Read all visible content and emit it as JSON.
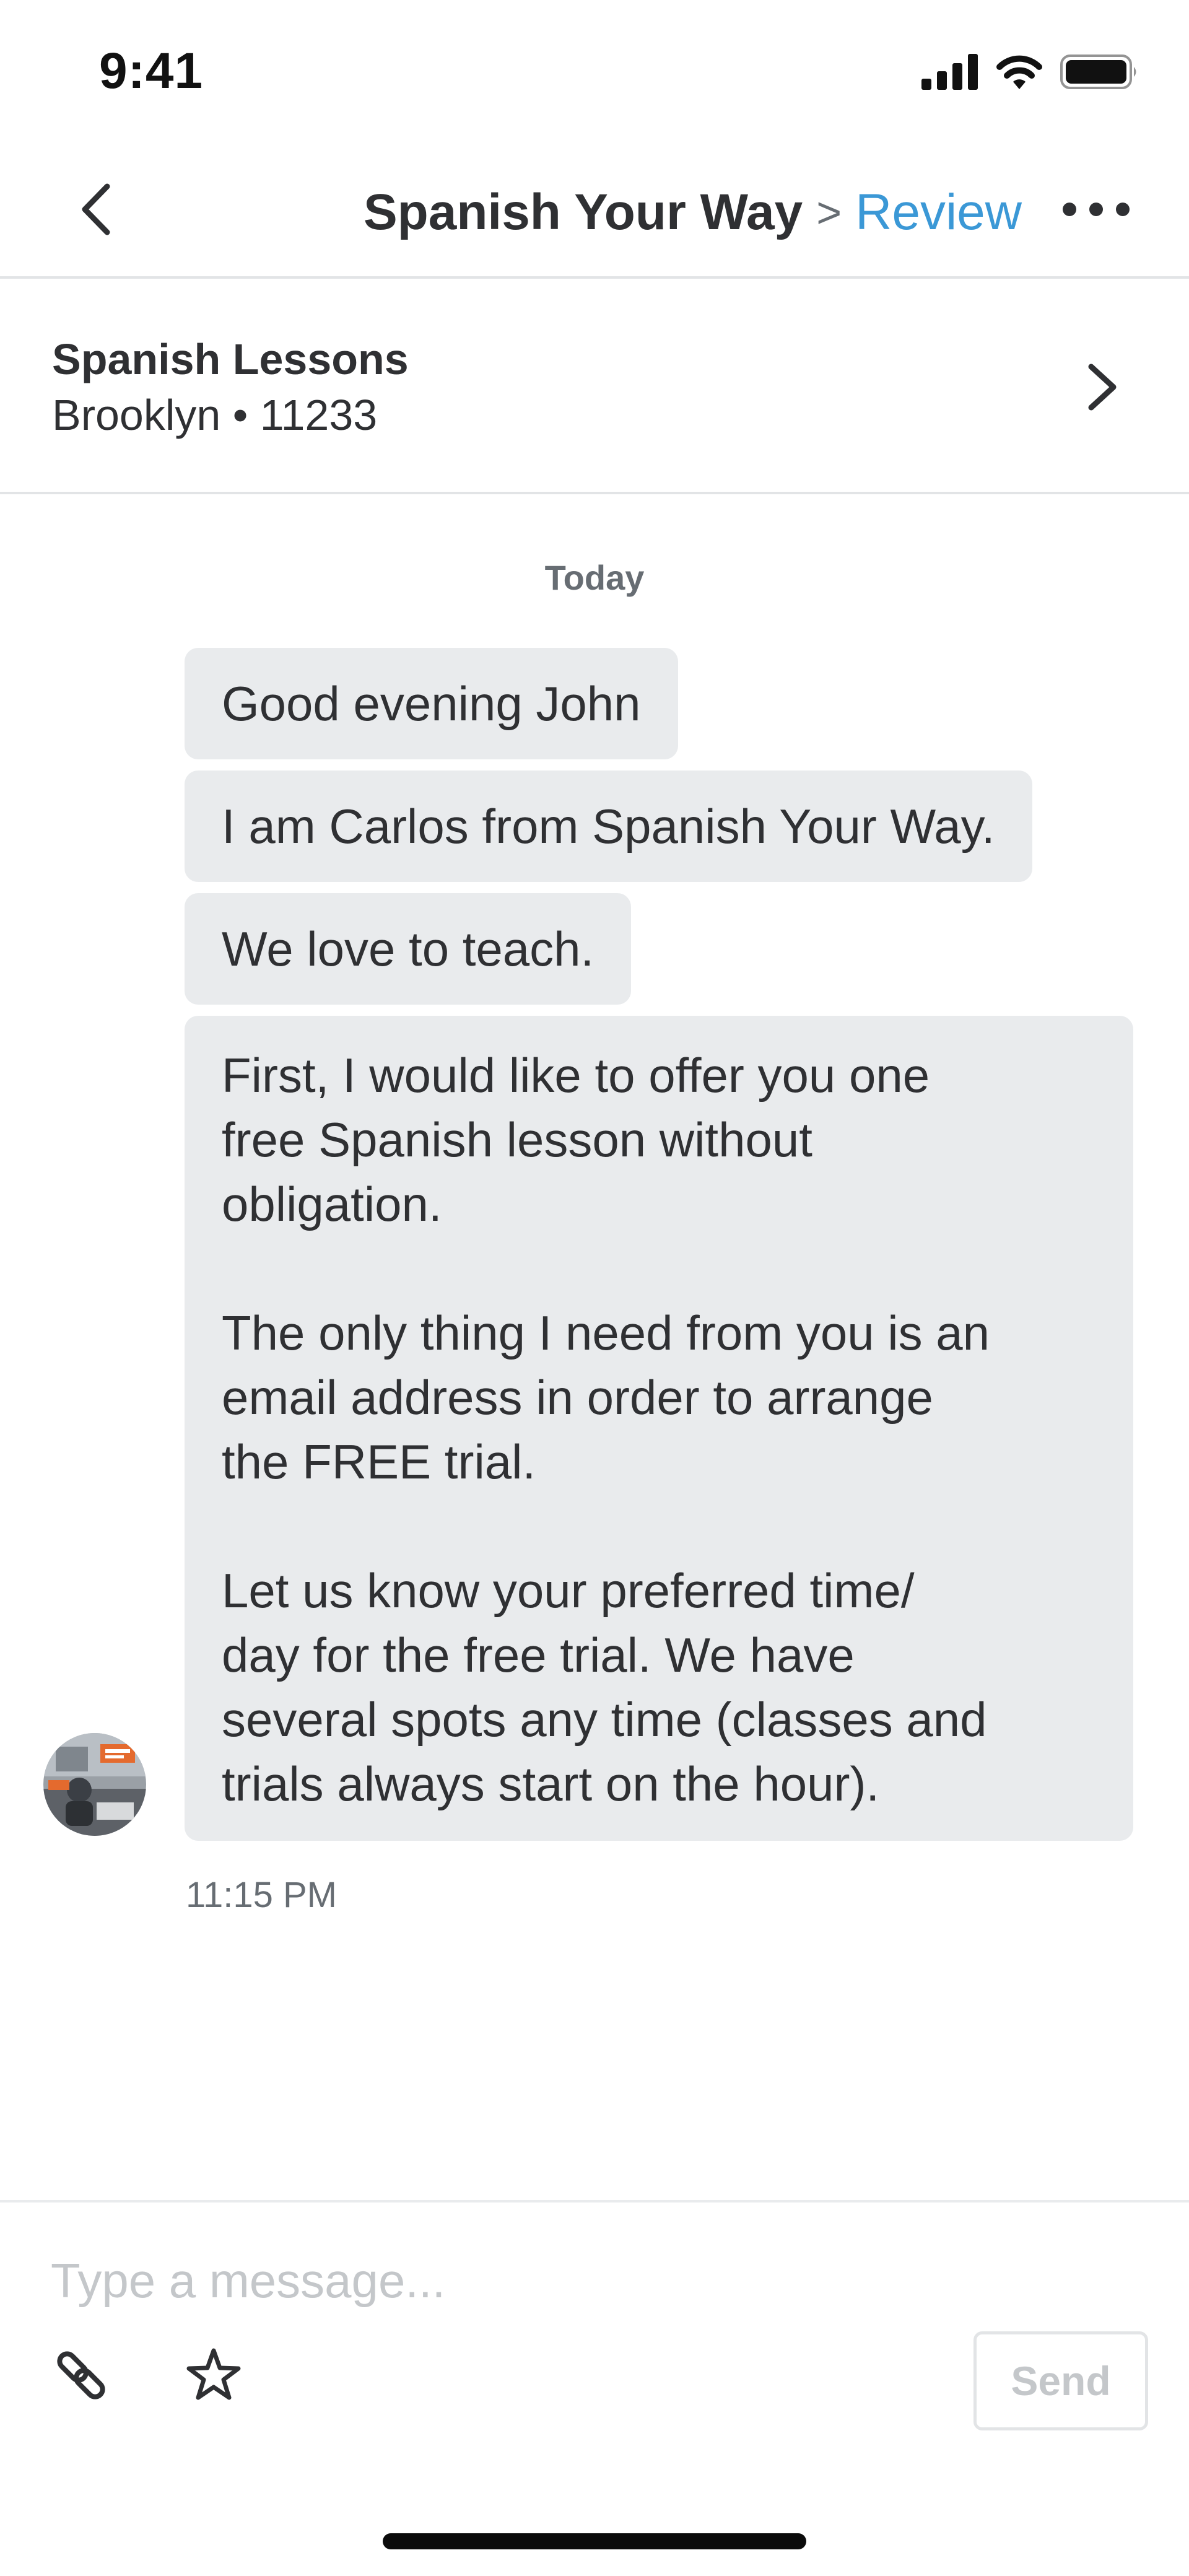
{
  "status_bar": {
    "time": "9:41",
    "icons": [
      "cellular-signal-icon",
      "wifi-icon",
      "battery-icon"
    ]
  },
  "header": {
    "back_icon": "chevron-left-icon",
    "pro_name": "Spanish Your Way",
    "separator": ">",
    "review_link": "Review",
    "more_icon": "more-horizontal-icon",
    "link_color": "#3b98d6"
  },
  "request": {
    "title": "Spanish Lessons",
    "subtitle": "Brooklyn • 11233",
    "chevron_icon": "chevron-right-icon"
  },
  "conversation": {
    "day_label": "Today",
    "messages": [
      "Good evening John",
      "I am Carlos from Spanish Your Way.",
      "We love to teach.",
      "First, I would like to offer you one\nfree Spanish lesson without\nobligation.\n\nThe only thing I need from you is an\nemail address in order to arrange\nthe FREE trial.\n\nLet us know your preferred time/\nday for the free trial. We have\nseveral spots any time (classes and\ntrials always start on the hour)."
    ],
    "timestamp": "11:15 PM",
    "avatar": "sender-avatar",
    "bubble_color": "#e9ebed"
  },
  "composer": {
    "input_value": "",
    "placeholder": "Type a message...",
    "attach_icon": "paperclip-icon",
    "star_icon": "star-icon",
    "send_label": "Send"
  }
}
